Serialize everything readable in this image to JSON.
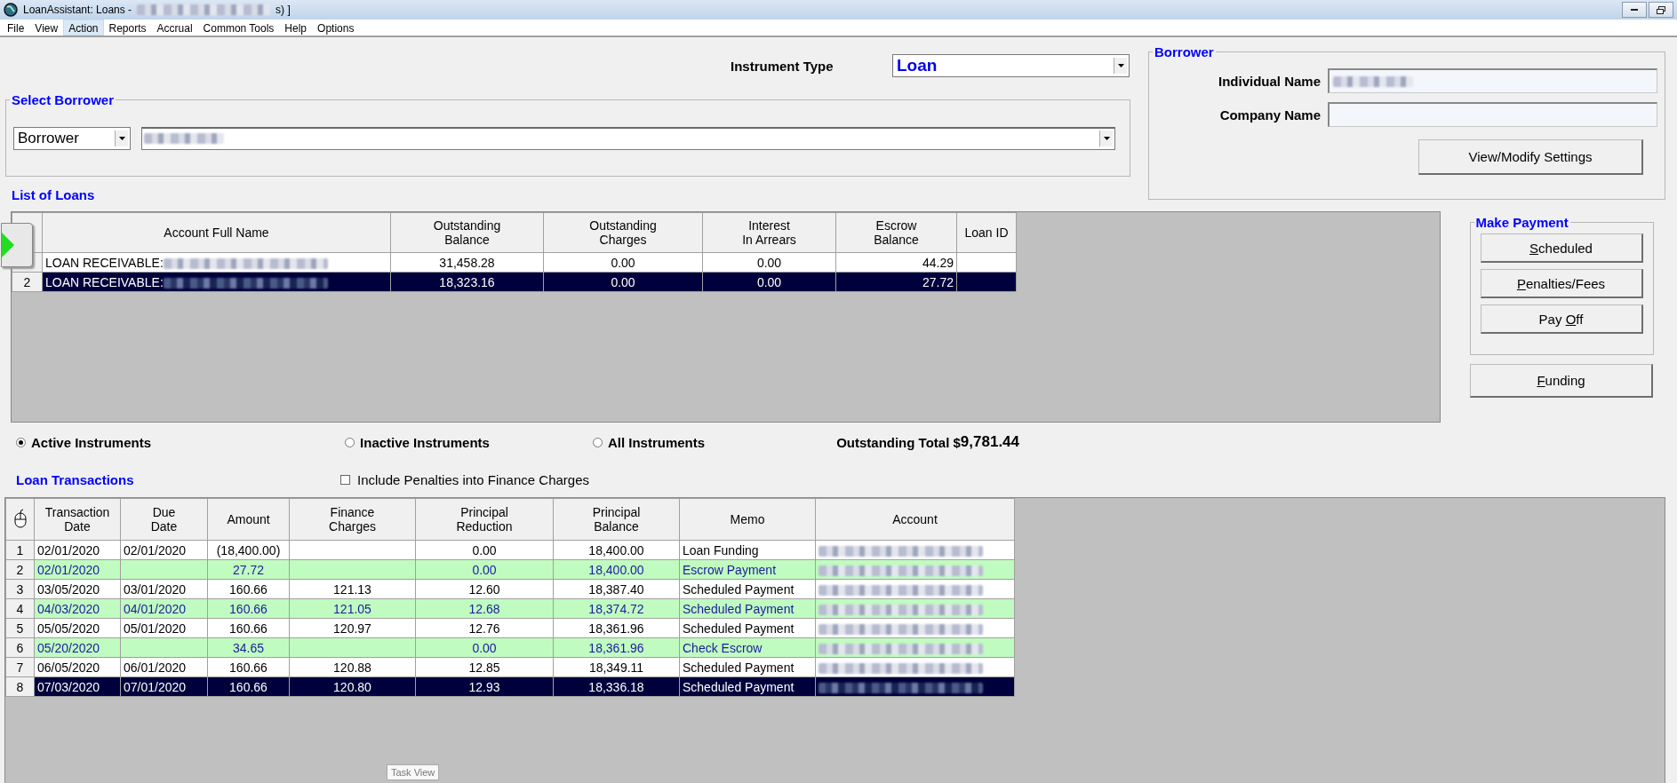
{
  "window": {
    "title": "LoanAssistant: Loans -",
    "title_suffix": "s) ]"
  },
  "menu": [
    {
      "label": "File",
      "selected": false
    },
    {
      "label": "View",
      "selected": false
    },
    {
      "label": "Action",
      "selected": true
    },
    {
      "label": "Reports",
      "selected": false
    },
    {
      "label": "Accrual",
      "selected": false
    },
    {
      "label": "Common Tools",
      "selected": false
    },
    {
      "label": "Help",
      "selected": false
    },
    {
      "label": "Options",
      "selected": false
    }
  ],
  "instrument_type": {
    "label": "Instrument Type",
    "value": "Loan"
  },
  "select_borrower": {
    "title": "Select Borrower",
    "type_value": "Borrower"
  },
  "borrower": {
    "title": "Borrower",
    "fields": [
      {
        "label": "Individual Name",
        "filled": true
      },
      {
        "label": "Company Name",
        "filled": false
      }
    ],
    "button": "View/Modify Settings"
  },
  "loans": {
    "title": "List of Loans",
    "columns": [
      "Account Full Name",
      "Outstanding\nBalance",
      "Outstanding\nCharges",
      "Interest\nIn Arrears",
      "Escrow\nBalance",
      "Loan ID"
    ],
    "rows": [
      {
        "account": "LOAN RECEIVABLE:",
        "outstanding_balance": "31,458.28",
        "outstanding_charges": "0.00",
        "interest_in_arrears": "0.00",
        "escrow_balance": "44.29",
        "selected": false
      },
      {
        "number": "2",
        "account": "LOAN RECEIVABLE:",
        "outstanding_balance": "18,323.16",
        "outstanding_charges": "0.00",
        "interest_in_arrears": "0.00",
        "escrow_balance": "27.72",
        "selected": true
      }
    ]
  },
  "make_payment": {
    "title": "Make Payment",
    "buttons": [
      {
        "key": "S",
        "post": "cheduled"
      },
      {
        "key": "P",
        "post": "enalties/Fees"
      },
      {
        "pre": "Pay ",
        "key": "O",
        "post": "ff"
      }
    ]
  },
  "funding": {
    "key": "F",
    "post": "unding"
  },
  "filters": [
    {
      "label": "Active Instruments",
      "selected": true
    },
    {
      "label": "Inactive Instruments",
      "selected": false
    },
    {
      "label": "All Instruments",
      "selected": false
    }
  ],
  "outstanding_total": {
    "label": "Outstanding Total $",
    "value": "9,781.44"
  },
  "transactions": {
    "title": "Loan Transactions",
    "include_penalties": {
      "label": "Include Penalties into Finance Charges",
      "checked": false
    },
    "columns": [
      "Transaction\nDate",
      "Due\nDate",
      "Amount",
      "Finance\nCharges",
      "Principal\nReduction",
      "Principal\nBalance",
      "Memo",
      "Account"
    ],
    "rows": [
      {
        "number": "1",
        "transaction_date": "02/01/2020",
        "due_date": "02/01/2020",
        "amount": "(18,400.00)",
        "principal_reduction": "0.00",
        "principal_balance": "18,400.00",
        "memo": "Loan Funding",
        "shaded": false,
        "selected": false
      },
      {
        "number": "2",
        "transaction_date": "02/01/2020",
        "amount": "27.72",
        "principal_reduction": "0.00",
        "principal_balance": "18,400.00",
        "memo": "Escrow Payment",
        "shaded": true,
        "selected": false
      },
      {
        "number": "3",
        "transaction_date": "03/05/2020",
        "due_date": "03/01/2020",
        "amount": "160.66",
        "finance_charges": "121.13",
        "principal_reduction": "12.60",
        "principal_balance": "18,387.40",
        "memo": "Scheduled Payment",
        "shaded": false,
        "selected": false
      },
      {
        "number": "4",
        "transaction_date": "04/03/2020",
        "due_date": "04/01/2020",
        "amount": "160.66",
        "finance_charges": "121.05",
        "principal_reduction": "12.68",
        "principal_balance": "18,374.72",
        "memo": "Scheduled Payment",
        "shaded": true,
        "selected": false
      },
      {
        "number": "5",
        "transaction_date": "05/05/2020",
        "due_date": "05/01/2020",
        "amount": "160.66",
        "finance_charges": "120.97",
        "principal_reduction": "12.76",
        "principal_balance": "18,361.96",
        "memo": "Scheduled Payment",
        "shaded": false,
        "selected": false
      },
      {
        "number": "6",
        "transaction_date": "05/20/2020",
        "amount": "34.65",
        "principal_reduction": "0.00",
        "principal_balance": "18,361.96",
        "memo": "Check Escrow",
        "shaded": true,
        "selected": false
      },
      {
        "number": "7",
        "transaction_date": "06/05/2020",
        "due_date": "06/01/2020",
        "amount": "160.66",
        "finance_charges": "120.88",
        "principal_reduction": "12.85",
        "principal_balance": "18,349.11",
        "memo": "Scheduled Payment",
        "shaded": false,
        "selected": false
      },
      {
        "number": "8",
        "transaction_date": "07/03/2020",
        "due_date": "07/01/2020",
        "amount": "160.66",
        "finance_charges": "120.80",
        "principal_reduction": "12.93",
        "principal_balance": "18,336.18",
        "memo": "Scheduled Payment",
        "shaded": false,
        "selected": true
      }
    ]
  },
  "tooltip": "Task View"
}
